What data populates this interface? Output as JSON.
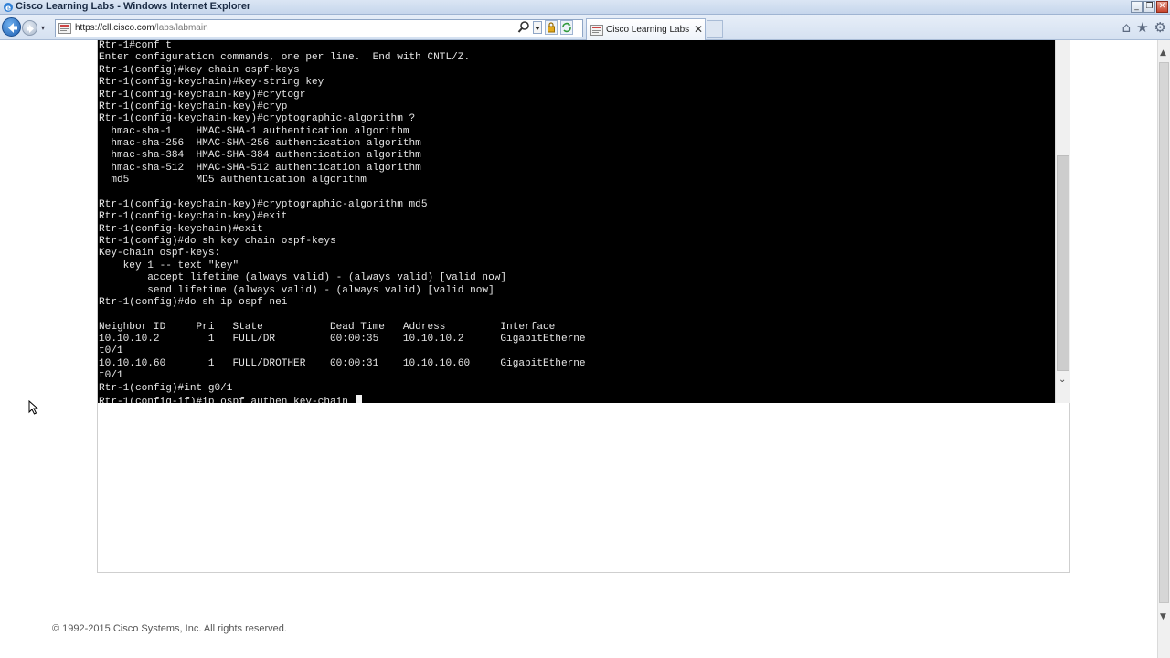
{
  "window": {
    "title": "Cisco Learning Labs - Windows Internet Explorer",
    "controls": {
      "minimize": "_",
      "restore": "❐",
      "close": "✕"
    }
  },
  "toolbar": {
    "back_icon": "back-arrow-icon",
    "forward_icon": "forward-arrow-icon",
    "history_dropdown": "▾",
    "address": {
      "url_host": "https://cll.cisco.com",
      "url_path": "/labs/labmain"
    },
    "address_tools": [
      "search-icon",
      "dropdown-icon",
      "lock-icon",
      "refresh-icon"
    ],
    "tab": {
      "label": "Cisco Learning Labs",
      "close": "✕"
    },
    "right_icons": {
      "home": "⌂",
      "favorites": "★",
      "tools": "⚙"
    }
  },
  "terminal": {
    "lines": [
      "Rtr-1#conf t",
      "Enter configuration commands, one per line.  End with CNTL/Z.",
      "Rtr-1(config)#key chain ospf-keys",
      "Rtr-1(config-keychain)#key-string key",
      "Rtr-1(config-keychain-key)#crytogr",
      "Rtr-1(config-keychain-key)#cryp",
      "Rtr-1(config-keychain-key)#cryptographic-algorithm ?",
      "  hmac-sha-1    HMAC-SHA-1 authentication algorithm",
      "  hmac-sha-256  HMAC-SHA-256 authentication algorithm",
      "  hmac-sha-384  HMAC-SHA-384 authentication algorithm",
      "  hmac-sha-512  HMAC-SHA-512 authentication algorithm",
      "  md5           MD5 authentication algorithm",
      "",
      "Rtr-1(config-keychain-key)#cryptographic-algorithm md5",
      "Rtr-1(config-keychain-key)#exit",
      "Rtr-1(config-keychain)#exit",
      "Rtr-1(config)#do sh key chain ospf-keys",
      "Key-chain ospf-keys:",
      "    key 1 -- text \"key\"",
      "        accept lifetime (always valid) - (always valid) [valid now]",
      "        send lifetime (always valid) - (always valid) [valid now]",
      "Rtr-1(config)#do sh ip ospf nei",
      "",
      "Neighbor ID     Pri   State           Dead Time   Address         Interface",
      "10.10.10.2        1   FULL/DR         00:00:35    10.10.10.2      GigabitEtherne",
      "t0/1",
      "10.10.10.60       1   FULL/DROTHER    00:00:31    10.10.10.60     GigabitEtherne",
      "t0/1",
      "Rtr-1(config)#int g0/1"
    ],
    "current_prompt": "Rtr-1(config-if)#ip ospf authen key-chain "
  },
  "footer": {
    "copyright": "© 1992-2015 Cisco Systems, Inc. All rights reserved."
  },
  "colors": {
    "terminal_bg": "#000000",
    "terminal_fg": "#e6e6e6",
    "titlebar": "#c6d6ec",
    "accent": "#1f5fb0"
  }
}
